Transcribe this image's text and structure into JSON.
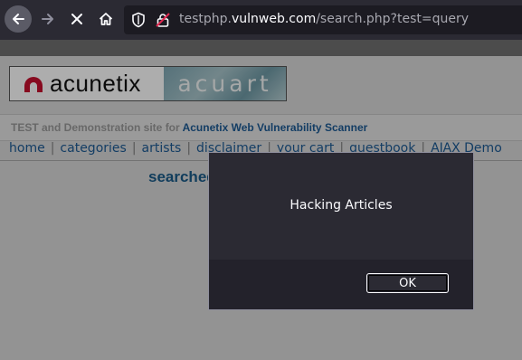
{
  "browser": {
    "url_host": "testphp.",
    "url_domain": "vulnweb.com",
    "url_path": "/search.php?test=query"
  },
  "site": {
    "logo_left": "acunetix",
    "logo_right": "acuart",
    "demo_prefix": "TEST and Demonstration site for ",
    "demo_link": "Acunetix Web Vulnerability Scanner",
    "menu": [
      "home",
      "categories",
      "artists",
      "disclaimer",
      "your cart",
      "guestbook",
      "AJAX Demo"
    ],
    "search_heading": "searched for: query"
  },
  "dialog": {
    "message": "Hacking Articles",
    "ok_label": "OK"
  },
  "colors": {
    "toolbar": "#2b2a33",
    "link": "#1d5a94",
    "logo_red": "#c8102e"
  }
}
